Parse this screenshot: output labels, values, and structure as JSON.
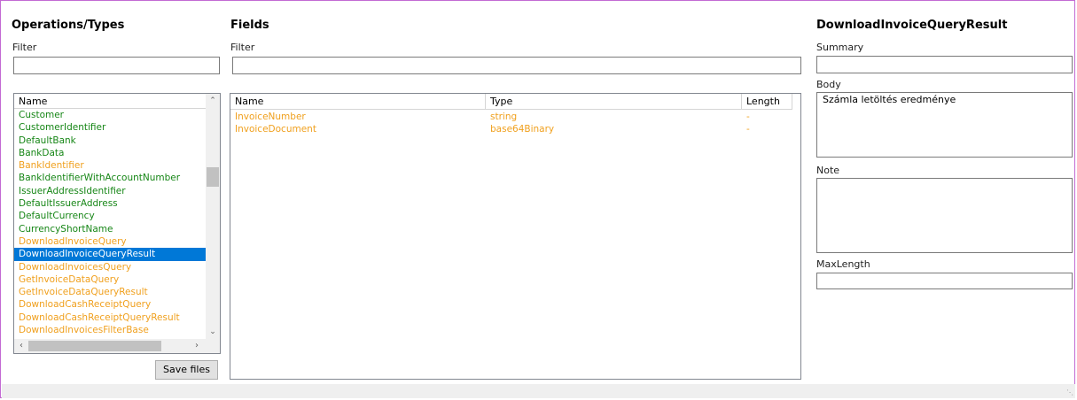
{
  "operations": {
    "title": "Operations/Types",
    "filter_label": "Filter",
    "filter_value": "",
    "column_name": "Name",
    "items": [
      {
        "label": "Customer",
        "color": "green"
      },
      {
        "label": "CustomerIdentifier",
        "color": "green"
      },
      {
        "label": "DefaultBank",
        "color": "green"
      },
      {
        "label": "BankData",
        "color": "green"
      },
      {
        "label": "BankIdentifier",
        "color": "orange"
      },
      {
        "label": "BankIdentifierWithAccountNumber",
        "color": "green"
      },
      {
        "label": "IssuerAddressIdentifier",
        "color": "green"
      },
      {
        "label": "DefaultIssuerAddress",
        "color": "green"
      },
      {
        "label": "DefaultCurrency",
        "color": "green"
      },
      {
        "label": "CurrencyShortName",
        "color": "green"
      },
      {
        "label": "DownloadInvoiceQuery",
        "color": "orange"
      },
      {
        "label": "DownloadInvoiceQueryResult",
        "color": "selected"
      },
      {
        "label": "DownloadInvoicesQuery",
        "color": "orange"
      },
      {
        "label": "GetInvoiceDataQuery",
        "color": "orange"
      },
      {
        "label": "GetInvoiceDataQueryResult",
        "color": "orange"
      },
      {
        "label": "DownloadCashReceiptQuery",
        "color": "orange"
      },
      {
        "label": "DownloadCashReceiptQueryResult",
        "color": "orange"
      },
      {
        "label": "DownloadInvoicesFilterBase",
        "color": "orange"
      }
    ],
    "save_label": "Save files"
  },
  "fields": {
    "title": "Fields",
    "filter_label": "Filter",
    "filter_value": "",
    "columns": {
      "name": "Name",
      "type": "Type",
      "length": "Length"
    },
    "rows": [
      {
        "name": "InvoiceNumber",
        "type": "string",
        "length": "-"
      },
      {
        "name": "InvoiceDocument",
        "type": "base64Binary",
        "length": "-"
      }
    ]
  },
  "details": {
    "title": "DownloadInvoiceQueryResult",
    "summary_label": "Summary",
    "summary_value": "",
    "body_label": "Body",
    "body_value": "Számla letöltés eredménye",
    "note_label": "Note",
    "note_value": "",
    "maxlength_label": "MaxLength",
    "maxlength_value": ""
  },
  "colors": {
    "green": "#168616",
    "orange": "#f0a01e",
    "selection": "#0078d7",
    "frame": "#c36ad3"
  },
  "icons": {
    "scroll_up": "chevron-up-icon",
    "scroll_down": "chevron-down-icon",
    "scroll_left": "chevron-left-icon",
    "scroll_right": "chevron-right-icon",
    "grip": "size-grip-icon"
  }
}
